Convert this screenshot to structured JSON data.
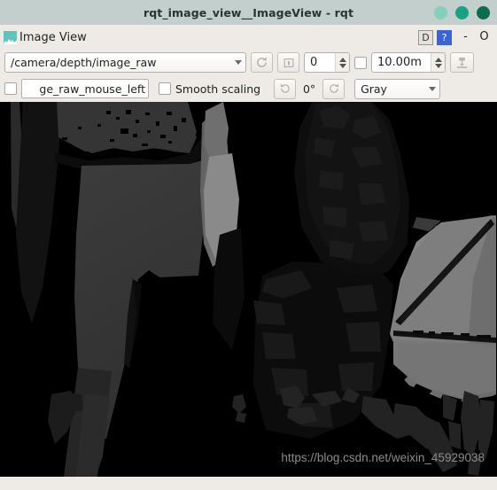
{
  "window": {
    "title": "rqt_image_view__ImageView - rqt",
    "buttons": {
      "minimize": "minimize",
      "maximize": "maximize",
      "close": "close"
    }
  },
  "plugin": {
    "icon": "image-view-icon",
    "title": "Image View",
    "dock_label": "D",
    "help_label": "?",
    "float_label": "-",
    "close_label": "O"
  },
  "toolbar_row1": {
    "topic_combo": {
      "value": "/camera/depth/image_raw",
      "caret": "chevron-down-icon"
    },
    "refresh_button": {
      "icon": "refresh-icon",
      "enabled": false
    },
    "save_as_image_button": {
      "icon": "numbered-image-icon",
      "enabled": false
    },
    "index_spin": {
      "value": "0"
    },
    "dynamic_range_checkbox": {
      "checked": false
    },
    "max_range_spin": {
      "value": "10.00m"
    },
    "publish_button": {
      "icon": "save-image-icon",
      "enabled": false
    }
  },
  "toolbar_row2": {
    "publish_click_checkbox": {
      "checked": false
    },
    "mouse_topic_field": {
      "value": "ge_raw_mouse_left"
    },
    "smooth_scaling_checkbox": {
      "checked": false,
      "label": "Smooth scaling"
    },
    "rotate_left_button": {
      "icon": "rotate-left-icon",
      "enabled": false
    },
    "rotation_label": "0°",
    "rotate_right_button": {
      "icon": "rotate-right-icon",
      "enabled": false
    },
    "colormap_combo": {
      "value": "Gray",
      "caret": "chevron-down-icon"
    }
  },
  "image_view": {
    "watermark": "https://blog.csdn.net/weixin_45929038",
    "alt": "depth-camera-image"
  },
  "colors": {
    "titlebar": "#c3cfcd",
    "chrome": "#eeebe6",
    "accent_teal": "#17a383",
    "help_blue": "#3b62d6",
    "canvas": "#000000",
    "watermark_text": "#8c8c8c"
  }
}
